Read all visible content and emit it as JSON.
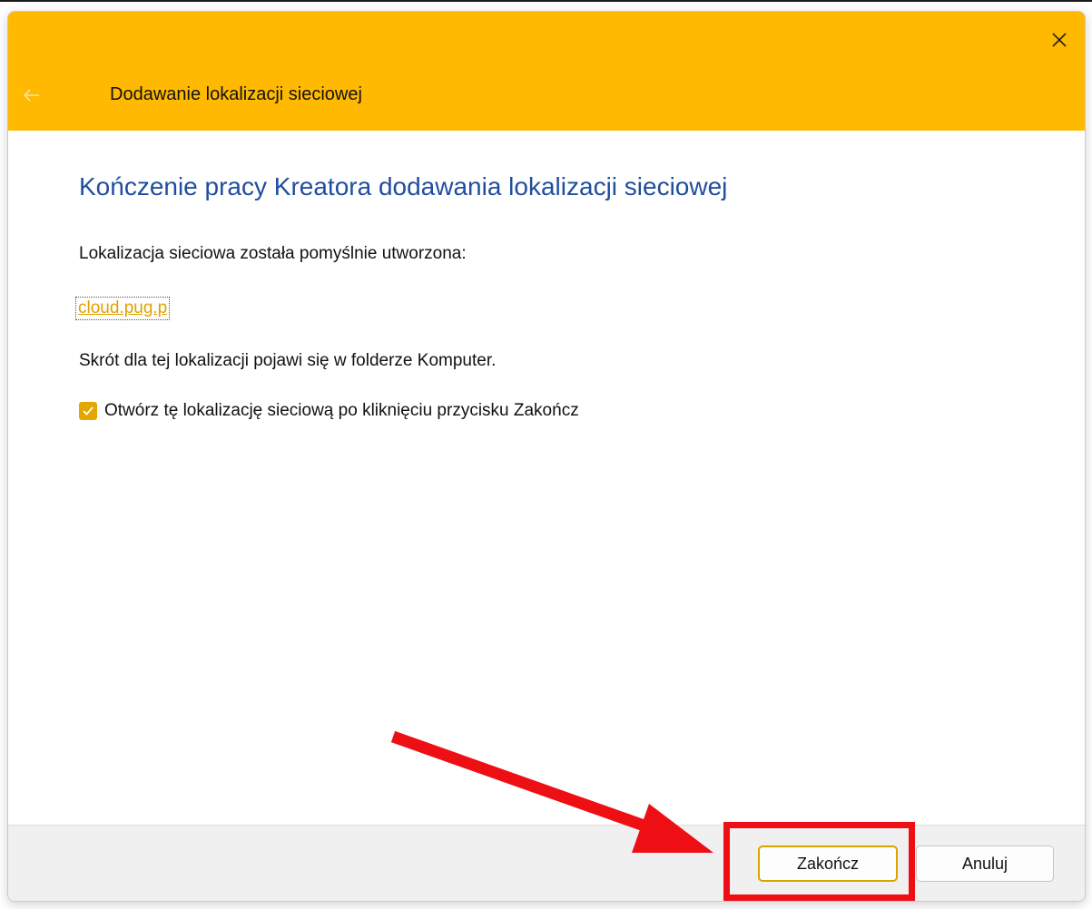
{
  "window": {
    "title": "Dodawanie lokalizacji sieciowej"
  },
  "content": {
    "heading": "Kończenie pracy Kreatora dodawania lokalizacji sieciowej",
    "success_text": "Lokalizacja sieciowa została pomyślnie utworzona:",
    "location_link": "cloud.pug.p",
    "shortcut_text": "Skrót dla tej lokalizacji pojawi się w folderze Komputer.",
    "open_checkbox": {
      "label": "Otwórz tę lokalizację sieciową po kliknięciu przycisku Zakończ",
      "checked": true
    }
  },
  "footer": {
    "finish_label": "Zakończ",
    "cancel_label": "Anuluj"
  },
  "colors": {
    "titlebar": "#ffb900",
    "heading": "#1f4e9e",
    "link": "#e0a100",
    "annotation": "#ee0f14"
  },
  "icons": {
    "close": "close-icon",
    "back": "back-arrow-icon",
    "check": "checkmark-icon"
  }
}
